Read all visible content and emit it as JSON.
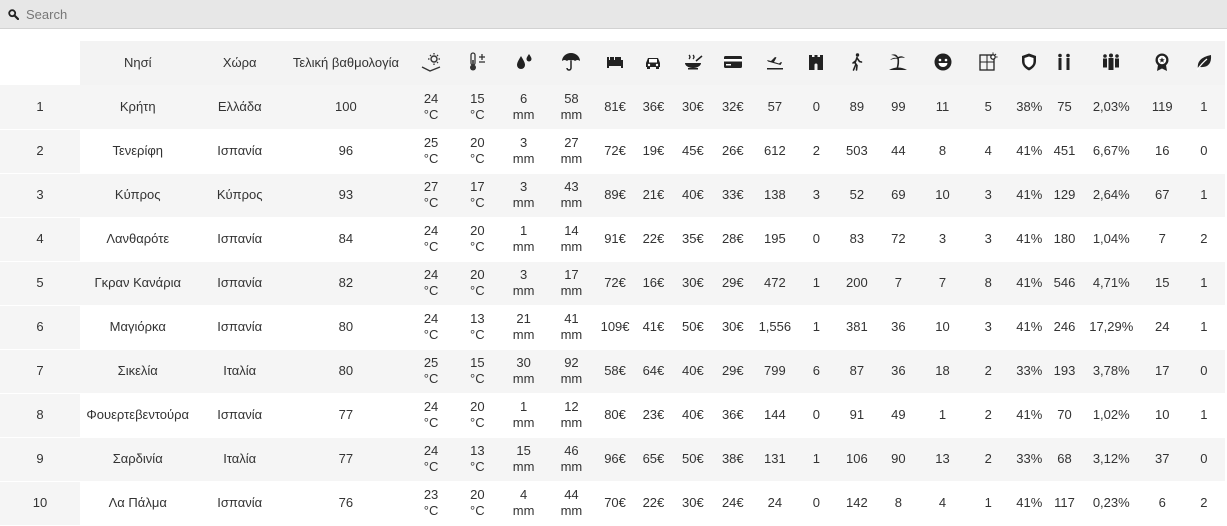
{
  "search": {
    "placeholder": "Search"
  },
  "columns": {
    "rank": "",
    "island": "Νησί",
    "country": "Χώρα",
    "score": "Τελική βαθμολογία",
    "icons": [
      {
        "key": "air_temp",
        "icon": "sun-thermometer-icon"
      },
      {
        "key": "sea_temp",
        "icon": "thermometer-plusminus-icon"
      },
      {
        "key": "rain",
        "icon": "rain-drops-icon"
      },
      {
        "key": "rain2",
        "icon": "umbrella-icon"
      },
      {
        "key": "hotel",
        "icon": "bed-icon"
      },
      {
        "key": "car",
        "icon": "car-icon"
      },
      {
        "key": "food",
        "icon": "food-bowl-icon"
      },
      {
        "key": "card",
        "icon": "credit-card-icon"
      },
      {
        "key": "flights",
        "icon": "plane-landing-icon"
      },
      {
        "key": "castles",
        "icon": "castle-icon"
      },
      {
        "key": "hiking",
        "icon": "hiking-person-icon"
      },
      {
        "key": "beaches",
        "icon": "beach-palm-icon"
      },
      {
        "key": "happy",
        "icon": "smiley-face-icon"
      },
      {
        "key": "sunshine",
        "icon": "sun-window-icon"
      },
      {
        "key": "safety",
        "icon": "shield-icon"
      },
      {
        "key": "tourists",
        "icon": "two-people-icon"
      },
      {
        "key": "crowd",
        "icon": "group-people-icon"
      },
      {
        "key": "awards",
        "icon": "award-badge-icon"
      },
      {
        "key": "eco",
        "icon": "leaf-icon"
      }
    ]
  },
  "rows": [
    {
      "rank": "1",
      "island": "Κρήτη",
      "country": "Ελλάδα",
      "score": "100",
      "air": [
        "24",
        "°C"
      ],
      "sea": [
        "15",
        "°C"
      ],
      "rain": [
        "6",
        "mm"
      ],
      "rain2": [
        "58",
        "mm"
      ],
      "hotel": "81€",
      "car": "36€",
      "food": "30€",
      "card": "32€",
      "flights": "57",
      "castles": "0",
      "hiking": "89",
      "beaches": "99",
      "happy": "11",
      "sunshine": "5",
      "safety": "38%",
      "tourists": "75",
      "crowd": "2,03%",
      "awards": "119",
      "eco": "1"
    },
    {
      "rank": "2",
      "island": "Τενερίφη",
      "country": "Ισπανία",
      "score": "96",
      "air": [
        "25",
        "°C"
      ],
      "sea": [
        "20",
        "°C"
      ],
      "rain": [
        "3",
        "mm"
      ],
      "rain2": [
        "27",
        "mm"
      ],
      "hotel": "72€",
      "car": "19€",
      "food": "45€",
      "card": "26€",
      "flights": "612",
      "castles": "2",
      "hiking": "503",
      "beaches": "44",
      "happy": "8",
      "sunshine": "4",
      "safety": "41%",
      "tourists": "451",
      "crowd": "6,67%",
      "awards": "16",
      "eco": "0"
    },
    {
      "rank": "3",
      "island": "Κύπρος",
      "country": "Κύπρος",
      "score": "93",
      "air": [
        "27",
        "°C"
      ],
      "sea": [
        "17",
        "°C"
      ],
      "rain": [
        "3",
        "mm"
      ],
      "rain2": [
        "43",
        "mm"
      ],
      "hotel": "89€",
      "car": "21€",
      "food": "40€",
      "card": "33€",
      "flights": "138",
      "castles": "3",
      "hiking": "52",
      "beaches": "69",
      "happy": "10",
      "sunshine": "3",
      "safety": "41%",
      "tourists": "129",
      "crowd": "2,64%",
      "awards": "67",
      "eco": "1"
    },
    {
      "rank": "4",
      "island": "Λανθαρότε",
      "country": "Ισπανία",
      "score": "84",
      "air": [
        "24",
        "°C"
      ],
      "sea": [
        "20",
        "°C"
      ],
      "rain": [
        "1",
        "mm"
      ],
      "rain2": [
        "14",
        "mm"
      ],
      "hotel": "91€",
      "car": "22€",
      "food": "35€",
      "card": "28€",
      "flights": "195",
      "castles": "0",
      "hiking": "83",
      "beaches": "72",
      "happy": "3",
      "sunshine": "3",
      "safety": "41%",
      "tourists": "180",
      "crowd": "1,04%",
      "awards": "7",
      "eco": "2"
    },
    {
      "rank": "5",
      "island": "Γκραν Κανάρια",
      "country": "Ισπανία",
      "score": "82",
      "air": [
        "24",
        "°C"
      ],
      "sea": [
        "20",
        "°C"
      ],
      "rain": [
        "3",
        "mm"
      ],
      "rain2": [
        "17",
        "mm"
      ],
      "hotel": "72€",
      "car": "16€",
      "food": "30€",
      "card": "29€",
      "flights": "472",
      "castles": "1",
      "hiking": "200",
      "beaches": "7",
      "happy": "7",
      "sunshine": "8",
      "safety": "41%",
      "tourists": "546",
      "crowd": "4,71%",
      "awards": "15",
      "eco": "1"
    },
    {
      "rank": "6",
      "island": "Μαγιόρκα",
      "country": "Ισπανία",
      "score": "80",
      "air": [
        "24",
        "°C"
      ],
      "sea": [
        "13",
        "°C"
      ],
      "rain": [
        "21",
        "mm"
      ],
      "rain2": [
        "41",
        "mm"
      ],
      "hotel": "109€",
      "car": "41€",
      "food": "50€",
      "card": "30€",
      "flights": "1,556",
      "castles": "1",
      "hiking": "381",
      "beaches": "36",
      "happy": "10",
      "sunshine": "3",
      "safety": "41%",
      "tourists": "246",
      "crowd": "17,29%",
      "awards": "24",
      "eco": "1"
    },
    {
      "rank": "7",
      "island": "Σικελία",
      "country": "Ιταλία",
      "score": "80",
      "air": [
        "25",
        "°C"
      ],
      "sea": [
        "15",
        "°C"
      ],
      "rain": [
        "30",
        "mm"
      ],
      "rain2": [
        "92",
        "mm"
      ],
      "hotel": "58€",
      "car": "64€",
      "food": "40€",
      "card": "29€",
      "flights": "799",
      "castles": "6",
      "hiking": "87",
      "beaches": "36",
      "happy": "18",
      "sunshine": "2",
      "safety": "33%",
      "tourists": "193",
      "crowd": "3,78%",
      "awards": "17",
      "eco": "0"
    },
    {
      "rank": "8",
      "island": "Φουερτεβεντούρα",
      "country": "Ισπανία",
      "score": "77",
      "air": [
        "24",
        "°C"
      ],
      "sea": [
        "20",
        "°C"
      ],
      "rain": [
        "1",
        "mm"
      ],
      "rain2": [
        "12",
        "mm"
      ],
      "hotel": "80€",
      "car": "23€",
      "food": "40€",
      "card": "36€",
      "flights": "144",
      "castles": "0",
      "hiking": "91",
      "beaches": "49",
      "happy": "1",
      "sunshine": "2",
      "safety": "41%",
      "tourists": "70",
      "crowd": "1,02%",
      "awards": "10",
      "eco": "1"
    },
    {
      "rank": "9",
      "island": "Σαρδινία",
      "country": "Ιταλία",
      "score": "77",
      "air": [
        "24",
        "°C"
      ],
      "sea": [
        "13",
        "°C"
      ],
      "rain": [
        "15",
        "mm"
      ],
      "rain2": [
        "46",
        "mm"
      ],
      "hotel": "96€",
      "car": "65€",
      "food": "50€",
      "card": "38€",
      "flights": "131",
      "castles": "1",
      "hiking": "106",
      "beaches": "90",
      "happy": "13",
      "sunshine": "2",
      "safety": "33%",
      "tourists": "68",
      "crowd": "3,12%",
      "awards": "37",
      "eco": "0"
    },
    {
      "rank": "10",
      "island": "Λα Πάλμα",
      "country": "Ισπανία",
      "score": "76",
      "air": [
        "23",
        "°C"
      ],
      "sea": [
        "20",
        "°C"
      ],
      "rain": [
        "4",
        "mm"
      ],
      "rain2": [
        "44",
        "mm"
      ],
      "hotel": "70€",
      "car": "22€",
      "food": "30€",
      "card": "24€",
      "flights": "24",
      "castles": "0",
      "hiking": "142",
      "beaches": "8",
      "happy": "4",
      "sunshine": "1",
      "safety": "41%",
      "tourists": "117",
      "crowd": "0,23%",
      "awards": "6",
      "eco": "2"
    }
  ]
}
